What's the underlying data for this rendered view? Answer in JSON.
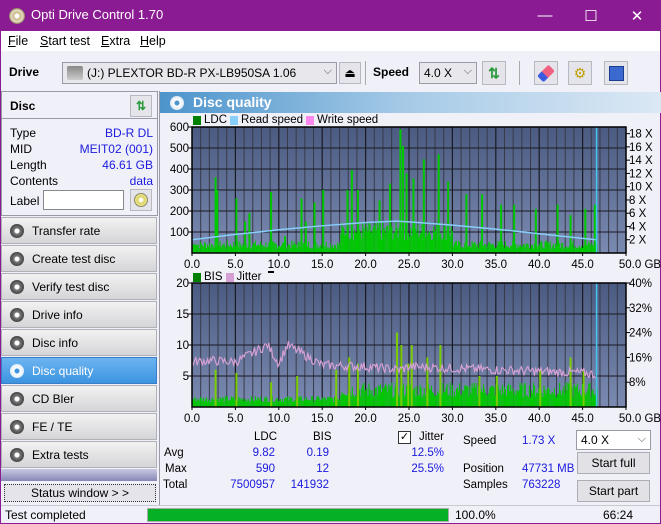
{
  "window": {
    "title": "Opti Drive Control 1.70",
    "minimize_glyph": "—",
    "maximize_glyph": "☐",
    "close_glyph": "✕"
  },
  "menu": [
    {
      "label": "File",
      "accel": "F",
      "rest": "ile"
    },
    {
      "label": "Start test",
      "accel": "S",
      "rest": "tart test"
    },
    {
      "label": "Extra",
      "accel": "E",
      "rest": "xtra"
    },
    {
      "label": "Help",
      "accel": "H",
      "rest": "elp"
    }
  ],
  "toolbar": {
    "drive_label": "Drive",
    "drive_value": "(J:)  PLEXTOR BD-R  PX-LB950SA 1.06",
    "speed_label": "Speed",
    "speed_value": "4.0 X"
  },
  "disc": {
    "header": "Disc",
    "rows": [
      {
        "key": "Type",
        "value": "BD-R DL"
      },
      {
        "key": "MID",
        "value": "MEIT02 (001)"
      },
      {
        "key": "Length",
        "value": "46.61 GB"
      },
      {
        "key": "Contents",
        "value": "data"
      }
    ],
    "label_key": "Label",
    "label_value": ""
  },
  "nav": [
    {
      "label": "Transfer rate",
      "active": false
    },
    {
      "label": "Create test disc",
      "active": false
    },
    {
      "label": "Verify test disc",
      "active": false
    },
    {
      "label": "Drive info",
      "active": false
    },
    {
      "label": "Disc info",
      "active": false
    },
    {
      "label": "Disc quality",
      "active": true
    },
    {
      "label": "CD Bler",
      "active": false
    },
    {
      "label": "FE / TE",
      "active": false
    },
    {
      "label": "Extra tests",
      "active": false
    }
  ],
  "status_window_label": "Status window > >",
  "panel": {
    "title": "Disc quality",
    "top_legend": [
      {
        "label": "LDC",
        "color": "#008000"
      },
      {
        "label": "Read speed",
        "color": "#87cefa"
      },
      {
        "label": "Write speed",
        "color": "#ff88ee"
      }
    ],
    "bottom_legend": [
      {
        "label": "BIS",
        "color": "#008000"
      },
      {
        "label": "Jitter",
        "color": "#d4a0d4"
      }
    ]
  },
  "chart_data": [
    {
      "type": "bar",
      "title": "LDC / Read speed",
      "xlabel": "GB",
      "x_ticks": [
        "0.0",
        "5.0",
        "10.0",
        "15.0",
        "20.0",
        "25.0",
        "30.0",
        "35.0",
        "40.0",
        "45.0",
        "50.0 GB"
      ],
      "xlim": [
        0,
        50
      ],
      "y_ticks": [
        "600",
        "500",
        "400",
        "300",
        "200",
        "100"
      ],
      "ylim": [
        0,
        600
      ],
      "y2_ticks": [
        "18 X",
        "16 X",
        "14 X",
        "12 X",
        "10 X",
        "8 X",
        "6 X",
        "4 X",
        "2 X"
      ],
      "y2lim": [
        0,
        19
      ],
      "end_marker_gb": 46.61,
      "series": [
        {
          "name": "LDC",
          "color": "#00c800",
          "peaks": [
            [
              0.3,
              40
            ],
            [
              2.6,
              360
            ],
            [
              2.8,
              300
            ],
            [
              5.0,
              260
            ],
            [
              6.0,
              150
            ],
            [
              6.5,
              190
            ],
            [
              9.0,
              290
            ],
            [
              10.6,
              80
            ],
            [
              12.5,
              260
            ],
            [
              13.0,
              150
            ],
            [
              14.0,
              240
            ],
            [
              15.0,
              300
            ],
            [
              17.8,
              300
            ],
            [
              18.3,
              395
            ],
            [
              19.0,
              300
            ],
            [
              21.5,
              250
            ],
            [
              22.7,
              330
            ],
            [
              23.9,
              590
            ],
            [
              24.2,
              510
            ],
            [
              24.6,
              380
            ],
            [
              25.4,
              355
            ],
            [
              26.6,
              445
            ],
            [
              28.3,
              470
            ],
            [
              29.4,
              340
            ],
            [
              31.5,
              280
            ],
            [
              33.3,
              280
            ],
            [
              35.5,
              230
            ],
            [
              37.0,
              230
            ],
            [
              39.5,
              210
            ],
            [
              42.0,
              230
            ],
            [
              43.5,
              180
            ],
            [
              45.2,
              210
            ],
            [
              46.3,
              230
            ]
          ]
        },
        {
          "name": "Read speed",
          "color": "#87cefa",
          "points": [
            [
              0,
              2.0
            ],
            [
              5,
              2.8
            ],
            [
              10,
              3.5
            ],
            [
              15,
              4.1
            ],
            [
              20,
              4.6
            ],
            [
              23.5,
              4.8
            ],
            [
              25,
              4.7
            ],
            [
              30,
              4.2
            ],
            [
              35,
              3.6
            ],
            [
              40,
              2.9
            ],
            [
              45,
              2.2
            ],
            [
              46.6,
              2.0
            ]
          ]
        }
      ]
    },
    {
      "type": "bar",
      "title": "BIS / Jitter",
      "xlabel": "GB",
      "x_ticks": [
        "0.0",
        "5.0",
        "10.0",
        "15.0",
        "20.0",
        "25.0",
        "30.0",
        "35.0",
        "40.0",
        "45.0",
        "50.0 GB"
      ],
      "xlim": [
        0,
        50
      ],
      "y_ticks": [
        "20",
        "15",
        "10",
        "5"
      ],
      "ylim": [
        0,
        20
      ],
      "y2_ticks": [
        "40%",
        "32%",
        "24%",
        "16%",
        "8%"
      ],
      "y2lim": [
        0,
        40
      ],
      "end_marker_gb": 46.61,
      "series": [
        {
          "name": "BIS",
          "color": "#00c800",
          "peaks": [
            [
              2.6,
              6
            ],
            [
              5.0,
              5.5
            ],
            [
              9.0,
              4
            ],
            [
              12.0,
              5
            ],
            [
              16.5,
              6
            ],
            [
              18.0,
              8
            ],
            [
              19.0,
              7
            ],
            [
              23.5,
              12
            ],
            [
              24.0,
              10
            ],
            [
              24.8,
              7
            ],
            [
              25.2,
              10
            ],
            [
              27.0,
              8
            ],
            [
              28.5,
              10
            ],
            [
              33.0,
              5
            ],
            [
              35.0,
              5
            ],
            [
              40.0,
              6
            ],
            [
              43.5,
              8
            ],
            [
              45.0,
              6
            ]
          ]
        },
        {
          "name": "Jitter",
          "color": "#d4a0d4",
          "points": [
            [
              0,
              14.5
            ],
            [
              2,
              15
            ],
            [
              5,
              14.5
            ],
            [
              8.7,
              20
            ],
            [
              10,
              14
            ],
            [
              11,
              20
            ],
            [
              15,
              13.5
            ],
            [
              20,
              13
            ],
            [
              24,
              12
            ],
            [
              25,
              13
            ],
            [
              30,
              12.5
            ],
            [
              35,
              12
            ],
            [
              40,
              11.5
            ],
            [
              45,
              11
            ],
            [
              46.6,
              10.5
            ]
          ]
        }
      ]
    }
  ],
  "stats": {
    "col_ldc": "LDC",
    "col_bis": "BIS",
    "jitter_label": "Jitter",
    "jitter_checked": true,
    "rows": [
      {
        "label": "Avg",
        "ldc": "9.82",
        "bis": "0.19",
        "jitter": "12.5%"
      },
      {
        "label": "Max",
        "ldc": "590",
        "bis": "12",
        "jitter": "25.5%"
      },
      {
        "label": "Total",
        "ldc": "7500957",
        "bis": "141932",
        "jitter": ""
      }
    ],
    "speed_label": "Speed",
    "speed_value": "1.73 X",
    "position_label": "Position",
    "position_value": "47731 MB",
    "samples_label": "Samples",
    "samples_value": "763228",
    "speed_select": "4.0 X",
    "start_full": "Start full",
    "start_part": "Start part"
  },
  "statusbar": {
    "text": "Test completed",
    "progress_percent": 100,
    "progress_label": "100.0%",
    "time": "66:24"
  }
}
